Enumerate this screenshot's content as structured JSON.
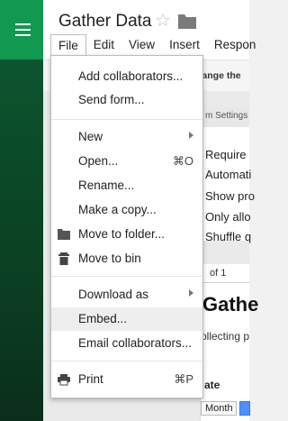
{
  "header": {
    "title": "Gather Data",
    "star_icon": "star-icon",
    "folder_icon": "folder-icon"
  },
  "menubar": [
    {
      "label": "File",
      "active": true
    },
    {
      "label": "Edit"
    },
    {
      "label": "View"
    },
    {
      "label": "Insert"
    },
    {
      "label": "Respon"
    }
  ],
  "toolbar": {
    "hint": "hange the"
  },
  "file_menu": {
    "items": [
      {
        "label": "Add collaborators..."
      },
      {
        "label": "Send form..."
      },
      {
        "label": "New",
        "submenu": true
      },
      {
        "label": "Open...",
        "shortcut": "⌘O"
      },
      {
        "label": "Rename..."
      },
      {
        "label": "Make a copy..."
      },
      {
        "label": "Move to folder...",
        "icon": "folder-icon"
      },
      {
        "label": "Move to bin",
        "icon": "trash-icon"
      },
      {
        "label": "Download as",
        "submenu": true
      },
      {
        "label": "Embed...",
        "highlighted": true
      },
      {
        "label": "Email collaborators..."
      },
      {
        "label": "Print",
        "shortcut": "⌘P",
        "icon": "printer-icon"
      }
    ]
  },
  "settings_panel": {
    "heading": "m Settings",
    "items": [
      "Require",
      "Automati",
      "Show pro",
      "Only allo",
      "Shuffle q"
    ]
  },
  "form_page": {
    "page_indicator": "of 1",
    "title": "Gathe",
    "description": "ollecting p",
    "date_label": "ate",
    "month_value": "Month"
  },
  "colors": {
    "brand_green": "#10994f",
    "menu_highlight": "#eeeeee",
    "accent_blue": "#4d90fe"
  }
}
